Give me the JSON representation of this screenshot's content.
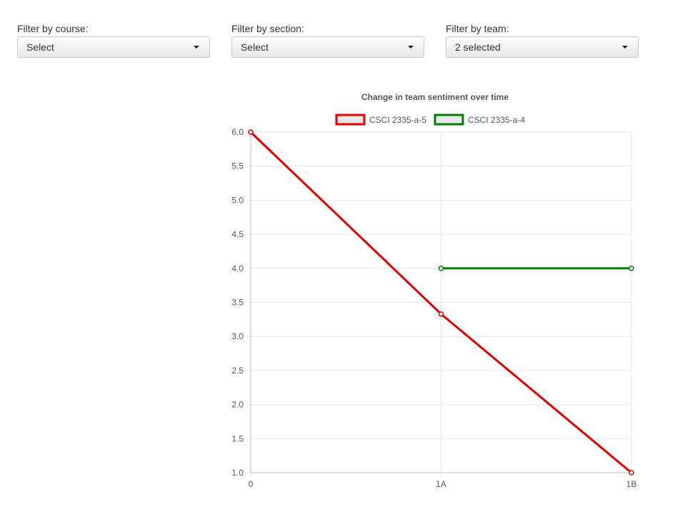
{
  "filters": {
    "course": {
      "label": "Filter by course:",
      "value": "Select"
    },
    "section": {
      "label": "Filter by section:",
      "value": "Select"
    },
    "team": {
      "label": "Filter by team:",
      "value": "2 selected"
    }
  },
  "chart_data": {
    "type": "line",
    "title": "Change in team sentiment over time",
    "xlabel": "",
    "ylabel": "",
    "categories": [
      "0",
      "1A",
      "1B"
    ],
    "ylim": [
      1.0,
      6.0
    ],
    "yticks": [
      "6.0",
      "5.5",
      "5.0",
      "4.5",
      "4.0",
      "3.5",
      "3.0",
      "2.5",
      "2.0",
      "1.5",
      "1.0"
    ],
    "grid": true,
    "legend_position": "top",
    "series": [
      {
        "name": "CSCI 2335-a-5",
        "color": "#e00000",
        "values": [
          6.0,
          3.33,
          1.0
        ]
      },
      {
        "name": "CSCI 2335-a-4",
        "color": "#008000",
        "values": [
          null,
          4.0,
          4.0
        ]
      }
    ]
  }
}
